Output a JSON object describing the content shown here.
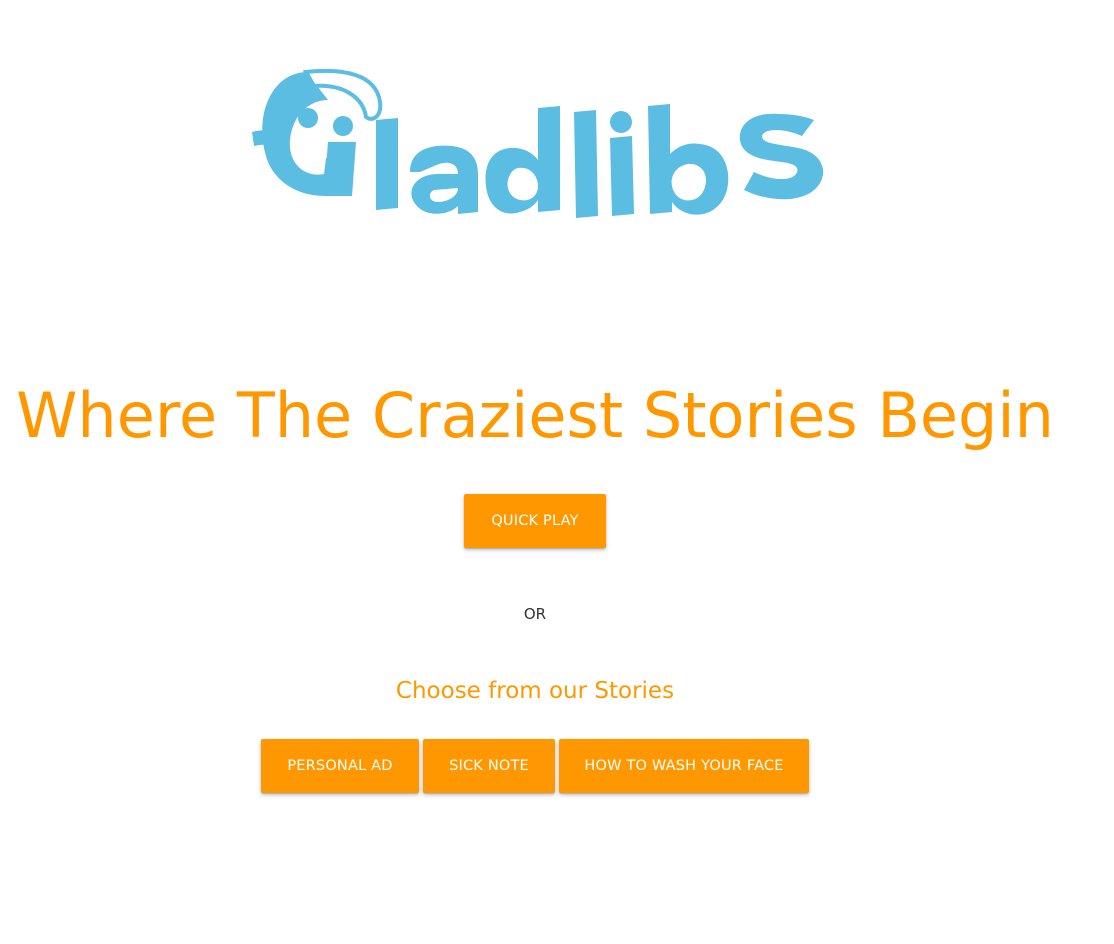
{
  "brand": {
    "logo_text": "Gladlibs",
    "logo_color": "#5bbde2"
  },
  "hero": {
    "headline": "Where The Craziest Stories Begin",
    "quick_play_label": "QUICK PLAY",
    "or_label": "OR",
    "stories_heading": "Choose from our Stories"
  },
  "stories": [
    {
      "label": "PERSONAL AD"
    },
    {
      "label": "SICK NOTE"
    },
    {
      "label": "HOW TO WASH YOUR FACE"
    }
  ],
  "colors": {
    "accent": "#ff9800",
    "button_text": "#ffffff",
    "body_text": "#333333"
  }
}
